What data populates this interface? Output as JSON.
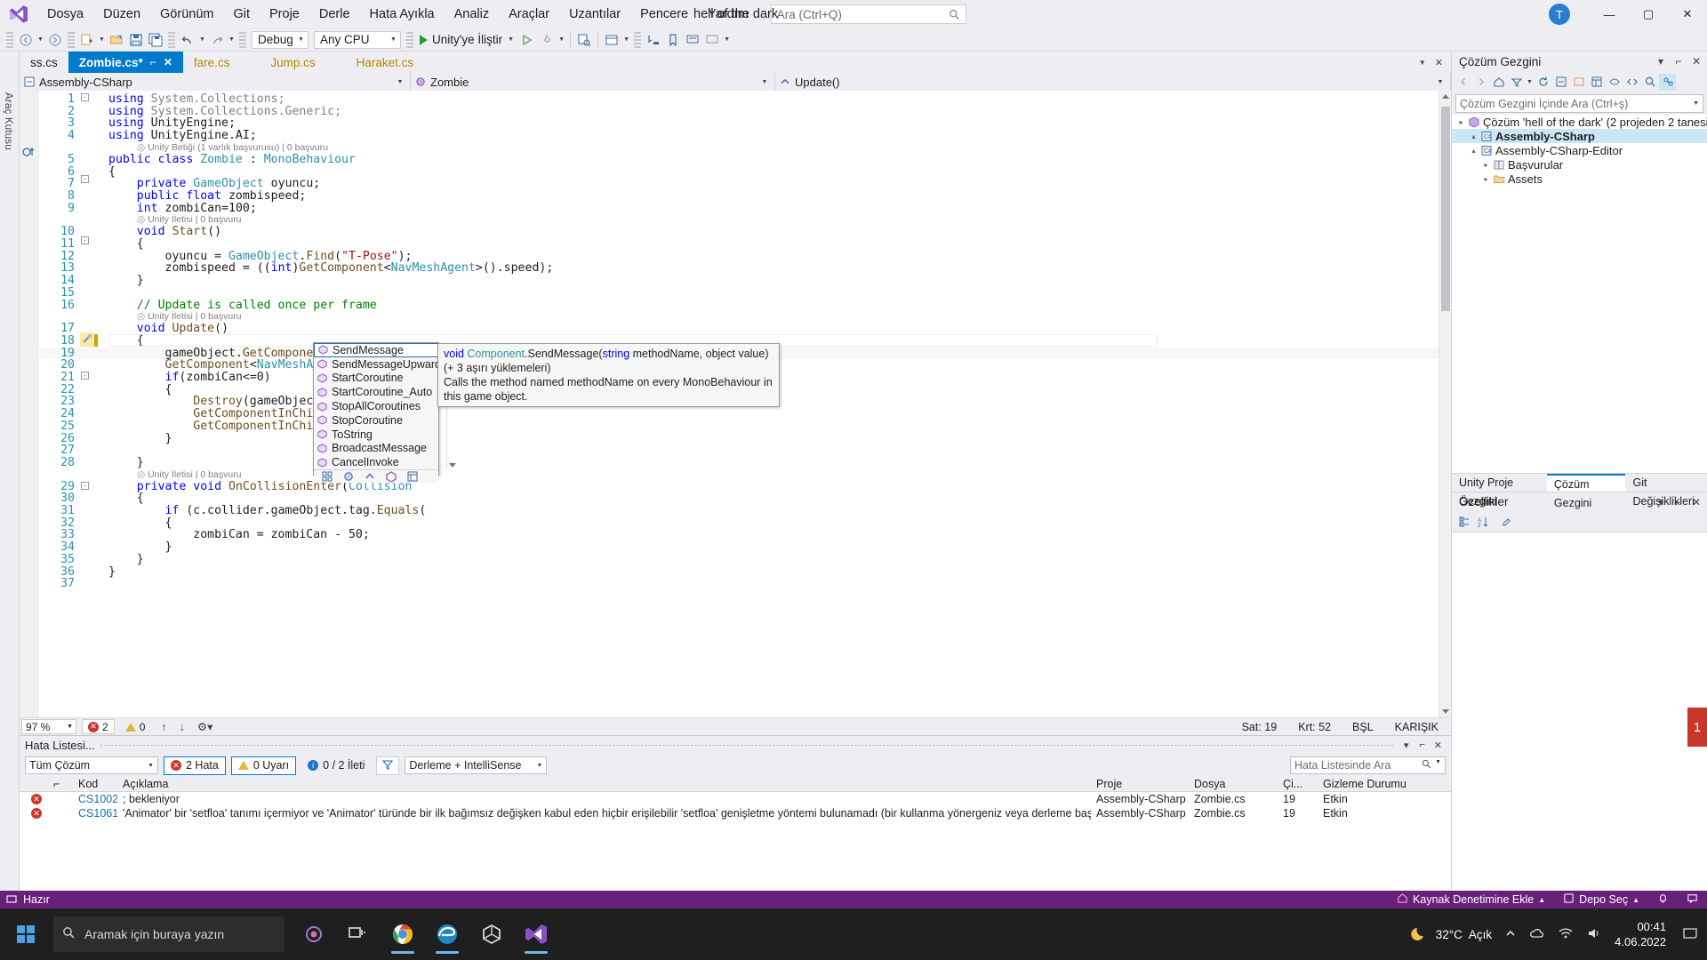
{
  "titlebar": {
    "logo": "visual-studio-logo",
    "menus": [
      "Dosya",
      "Düzen",
      "Görünüm",
      "Git",
      "Proje",
      "Derle",
      "Hata Ayıkla",
      "Analiz",
      "Araçlar",
      "Uzantılar",
      "Pencere",
      "Yardım"
    ],
    "search_placeholder": "Ara (Ctrl+Q)",
    "solution_title": "hell of the dark",
    "account_initial": "T",
    "minimize": "—",
    "maximize": "▢",
    "close": "✕"
  },
  "toolbar": {
    "back": "◀",
    "forward": "▶",
    "config": "Debug",
    "platform": "Any CPU",
    "run_label": "Unity'ye İliştir",
    "items": [
      "new-item-icon",
      "open-file-icon",
      "save-icon",
      "save-all-icon",
      "undo-icon",
      "redo-icon"
    ]
  },
  "left_strip": {
    "tabs": [
      "Araç Kutusu"
    ]
  },
  "document_tabs": [
    {
      "label": "ss.cs",
      "active": false,
      "style": "plain"
    },
    {
      "label": "Zombie.cs*",
      "active": true,
      "style": "plain",
      "pin": "⌐",
      "close": "✕"
    },
    {
      "label": "fare.cs",
      "active": false,
      "style": "yellow"
    },
    {
      "label": "Jump.cs",
      "active": false,
      "style": "yellow"
    },
    {
      "label": "Haraket.cs",
      "active": false,
      "style": "yellow"
    }
  ],
  "nav_bar": {
    "project": "Assembly-CSharp",
    "type": "Zombie",
    "member": "Update()"
  },
  "code": {
    "lines": [
      {
        "n": 1,
        "html": "<span class='k'>using</span> <span class='g'>System.Collections;</span>"
      },
      {
        "n": 2,
        "html": "<span class='k'>using</span> <span class='g'>System.Collections.Generic;</span>"
      },
      {
        "n": 3,
        "html": "<span class='k'>using</span> <span class='id'>UnityEngine;</span>"
      },
      {
        "n": 4,
        "html": "<span class='k'>using</span> <span class='id'>UnityEngine.AI;</span>"
      },
      {
        "n": 5,
        "html": "<span class='k'>public class</span> <span class='t'>Zombie</span> : <span class='t'>MonoBehaviour</span>"
      },
      {
        "n": 6,
        "html": "{"
      },
      {
        "n": 7,
        "html": "    <span class='k'>private</span> <span class='t'>GameObject</span> oyuncu;"
      },
      {
        "n": 8,
        "html": "    <span class='k'>public float</span> zombispeed;"
      },
      {
        "n": 9,
        "html": "    <span class='k'>int</span> zombiCan=<span class='id'>100</span>;"
      },
      {
        "n": 10,
        "html": "    <span class='k'>void</span> <span class='m'>Start</span>()"
      },
      {
        "n": 11,
        "html": "    {"
      },
      {
        "n": 12,
        "html": "        oyuncu = <span class='t'>GameObject</span>.<span class='m'>Find</span>(<span class='s'>\"T-Pose\"</span>);"
      },
      {
        "n": 13,
        "html": "        zombispeed = ((<span class='k'>int</span>)<span class='m'>GetComponent</span>&lt;<span class='t'>NavMeshAgent</span>&gt;().speed);"
      },
      {
        "n": 14,
        "html": "    }"
      },
      {
        "n": 15,
        "html": ""
      },
      {
        "n": 16,
        "html": "    <span class='c'>// Update is called once per frame</span>"
      },
      {
        "n": 17,
        "html": "    <span class='k'>void</span> <span class='m'>Update</span>()"
      },
      {
        "n": 18,
        "html": "    {"
      },
      {
        "n": 19,
        "html": "        gameObject.<span class='m'>GetComponent</span>&lt;<span class='t'>Animator</span>&gt;().<span class='squig'>setfloa</span>"
      },
      {
        "n": 20,
        "html": "        <span class='m'>GetComponent</span>&lt;<span class='t'>NavMeshAgent</span>&gt;().destina"
      },
      {
        "n": 21,
        "html": "        <span class='k'>if</span>(zombiCan&lt;=<span class='id'>0</span>)"
      },
      {
        "n": 22,
        "html": "        {"
      },
      {
        "n": 23,
        "html": "            <span class='m'>Destroy</span>(gameObject, <span class='id'>1.042f</span>  );"
      },
      {
        "n": 24,
        "html": "            <span class='m'>GetComponentInChildren</span>&lt;<span class='t'>Animation</span>"
      },
      {
        "n": 25,
        "html": "            <span class='m'>GetComponentInChildren</span>&lt;<span class='t'>NavMeshAg</span>"
      },
      {
        "n": 26,
        "html": "        }"
      },
      {
        "n": 27,
        "html": ""
      },
      {
        "n": 28,
        "html": "    }"
      },
      {
        "n": 29,
        "html": "    <span class='k'>private void</span> <span class='m'>OnCollisionEnter</span>(<span class='t'>Collision</span>"
      },
      {
        "n": 30,
        "html": "    {"
      },
      {
        "n": 31,
        "html": "        <span class='k'>if</span> (c.collider.gameObject.tag.<span class='m'>Equals</span>("
      },
      {
        "n": 32,
        "html": "        {"
      },
      {
        "n": 33,
        "html": "            zombiCan = zombiCan - <span class='id'>50</span>;"
      },
      {
        "n": 34,
        "html": "        }"
      },
      {
        "n": 35,
        "html": "    }"
      },
      {
        "n": 36,
        "html": "}"
      },
      {
        "n": 37,
        "html": ""
      }
    ],
    "codelens": [
      {
        "after_line": 4,
        "text": "Unity Betiği (1 varlık başvurusu) | 0 başvuru"
      },
      {
        "after_line": 9,
        "text": "Unity İletisi | 0 başvuru"
      },
      {
        "after_line": 16,
        "text": "Unity İletisi | 0 başvuru"
      },
      {
        "after_line": 28,
        "text": "Unity İletisi | 0 başvuru"
      }
    ]
  },
  "intellisense": {
    "items": [
      {
        "label": "SendMessage",
        "selected": true
      },
      {
        "label": "SendMessageUpwards",
        "selected": false
      },
      {
        "label": "StartCoroutine",
        "selected": false
      },
      {
        "label": "StartCoroutine_Auto",
        "selected": false
      },
      {
        "label": "StopAllCoroutines",
        "selected": false
      },
      {
        "label": "StopCoroutine",
        "selected": false
      },
      {
        "label": "ToString",
        "selected": false
      },
      {
        "label": "BroadcastMessage",
        "selected": false
      },
      {
        "label": "CancelInvoke",
        "selected": false
      }
    ],
    "footer_icons": [
      "all-members-icon",
      "classes-icon",
      "methods-icon",
      "properties-icon",
      "snippets-icon"
    ],
    "tooltip": {
      "signature_prefix": "void ",
      "signature_owner": "Component",
      "signature_rest": ".SendMessage(",
      "signature_param_kw": "string",
      "signature_param": " methodName, object value) (+ 3 aşırı yüklemeleri)",
      "description": "Calls the method named methodName on every MonoBehaviour in this game object."
    }
  },
  "editor_status": {
    "zoom": "97 %",
    "error_count": "2",
    "warn_count": "0",
    "line_label": "Sat: 19",
    "col_label": "Krt: 52",
    "char_label": "BŞL",
    "mode_label": "KARIŞIK"
  },
  "solution_explorer": {
    "title": "Çözüm Gezgini",
    "search_placeholder": "Çözüm Gezgini İçinde Ara (Ctrl+ş)",
    "tree": [
      {
        "depth": 0,
        "exp": "▸",
        "icon": "solution-icon",
        "label": "Çözüm 'hell of the dark' (2 projeden 2 tanesi)",
        "selected": false
      },
      {
        "depth": 1,
        "exp": "▴",
        "icon": "csharp-project-icon",
        "label": "Assembly-CSharp",
        "selected": true,
        "bold": true
      },
      {
        "depth": 1,
        "exp": "▴",
        "icon": "csharp-project-icon",
        "label": "Assembly-CSharp-Editor",
        "selected": false
      },
      {
        "depth": 2,
        "exp": "▸",
        "icon": "references-icon",
        "label": "Başvurular",
        "selected": false
      },
      {
        "depth": 2,
        "exp": "▸",
        "icon": "folder-icon",
        "label": "Assets",
        "selected": false
      }
    ],
    "bottom_tabs": [
      {
        "label": "Unity Proje Gezgini",
        "active": false
      },
      {
        "label": "Çözüm Gezgini",
        "active": true
      },
      {
        "label": "Git Değişiklikleri",
        "active": false
      }
    ]
  },
  "properties": {
    "title": "Özellikler"
  },
  "error_list": {
    "title": "Hata Listesi...",
    "scope": "Tüm Çözüm",
    "errors_label": "2 Hata",
    "warnings_label": "0 Uyarı",
    "messages_label": "0 / 2 İleti",
    "filter": "Derleme + IntelliSense",
    "search_placeholder": "Hata Listesinde Ara",
    "columns": [
      "",
      "",
      "Kod",
      "Açıklama",
      "Proje",
      "Dosya",
      "Çi...",
      "Gizleme Durumu"
    ],
    "rows": [
      {
        "code": "CS1002",
        "description": "; bekleniyor",
        "project": "Assembly-CSharp",
        "file": "Zombie.cs",
        "line": "19",
        "suppression": "Etkin"
      },
      {
        "code": "CS1061",
        "description": "'Animator' bir 'setfloa' tanımı içermiyor ve 'Animator' türünde bir ilk bağımsız değişken kabul eden hiçbir erişilebilir 'setfloa' genişletme yöntemi bulunamadı (bir kullanma yönergeniz veya derleme başvurunuz eksik olabilir mi?)",
        "project": "Assembly-CSharp",
        "file": "Zombie.cs",
        "line": "19",
        "suppression": "Etkin"
      }
    ]
  },
  "status_bar": {
    "ready": "Hazır",
    "source_control": "Kaynak Denetimine Ekle",
    "repo": "Depo Seç",
    "arrow": "▲"
  },
  "taskbar": {
    "search_placeholder": "Aramak için buraya yazın",
    "apps": [
      "task-view-icon",
      "edge-icon",
      "chrome-icon",
      "unity-icon",
      "visual-studio-icon"
    ],
    "weather_temp": "32°C",
    "weather_desc": "Açık",
    "time": "00:41",
    "date": "4.06.2022",
    "notification_count": "1"
  },
  "colors": {
    "accent": "#007acc",
    "status_purple": "#68217a",
    "error_red": "#c9372c",
    "warn_yellow": "#e8b33a",
    "keyword_blue": "#0000ff",
    "type_teal": "#2b91af",
    "string_red": "#a31515",
    "comment_green": "#008000"
  }
}
